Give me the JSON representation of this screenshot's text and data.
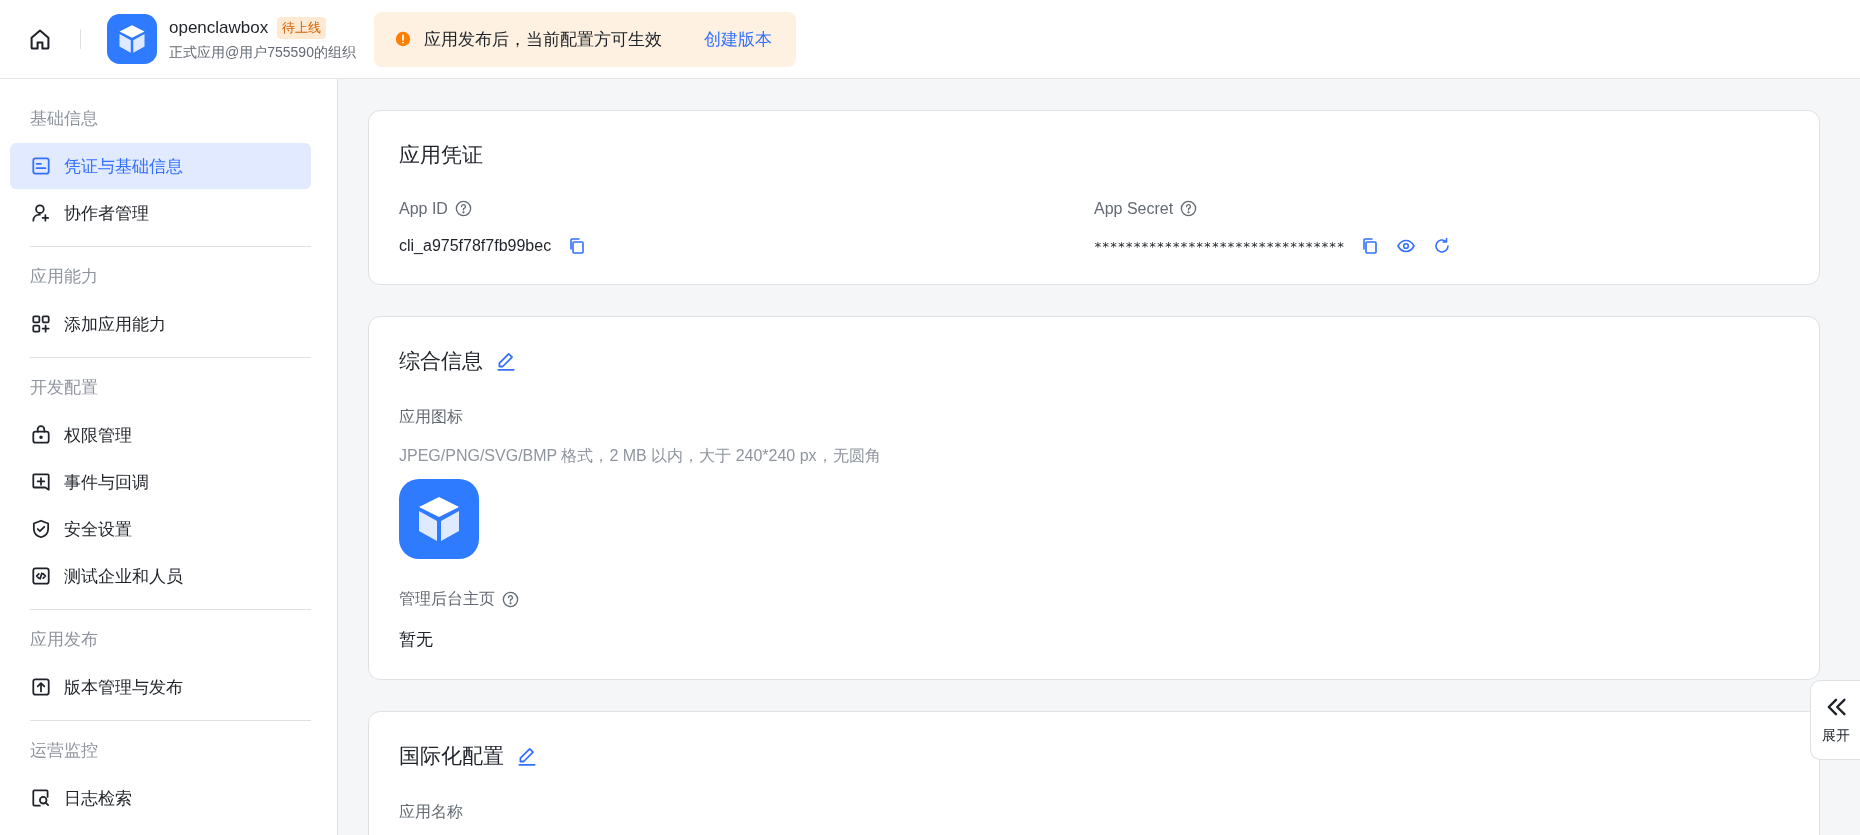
{
  "header": {
    "app_name": "openclawbox",
    "status_tag": "待上线",
    "org": "正式应用@用户755590的组织",
    "notice": {
      "text": "应用发布后，当前配置方可生效",
      "link": "创建版本"
    }
  },
  "sidebar": {
    "sections": [
      {
        "title": "基础信息",
        "items": [
          {
            "label": "凭证与基础信息",
            "kind": "card",
            "selected": true
          },
          {
            "label": "协作者管理",
            "kind": "user-add",
            "selected": false
          }
        ]
      },
      {
        "title": "应用能力",
        "items": [
          {
            "label": "添加应用能力",
            "kind": "grid-add",
            "selected": false
          }
        ]
      },
      {
        "title": "开发配置",
        "items": [
          {
            "label": "权限管理",
            "kind": "lock",
            "selected": false
          },
          {
            "label": "事件与回调",
            "kind": "event",
            "selected": false
          },
          {
            "label": "安全设置",
            "kind": "shield",
            "selected": false
          },
          {
            "label": "测试企业和人员",
            "kind": "code",
            "selected": false
          }
        ]
      },
      {
        "title": "应用发布",
        "items": [
          {
            "label": "版本管理与发布",
            "kind": "upload",
            "selected": false
          }
        ]
      },
      {
        "title": "运营监控",
        "items": [
          {
            "label": "日志检索",
            "kind": "search-doc",
            "selected": false
          }
        ]
      }
    ]
  },
  "credentials": {
    "title": "应用凭证",
    "fields": [
      {
        "label": "App ID",
        "value": "cli_a975f78f7fb99bec",
        "kind": "id"
      },
      {
        "label": "App Secret",
        "value": "********************************",
        "kind": "secret"
      }
    ]
  },
  "info": {
    "title": "综合信息",
    "icon_label": "应用图标",
    "icon_hint": "JPEG/PNG/SVG/BMP 格式，2 MB 以内，大于 240*240 px，无圆角",
    "homepage_label": "管理后台主页",
    "homepage_value": "暂无"
  },
  "i18n": {
    "title": "国际化配置",
    "field_label": "应用名称"
  },
  "expand_button": "展开"
}
